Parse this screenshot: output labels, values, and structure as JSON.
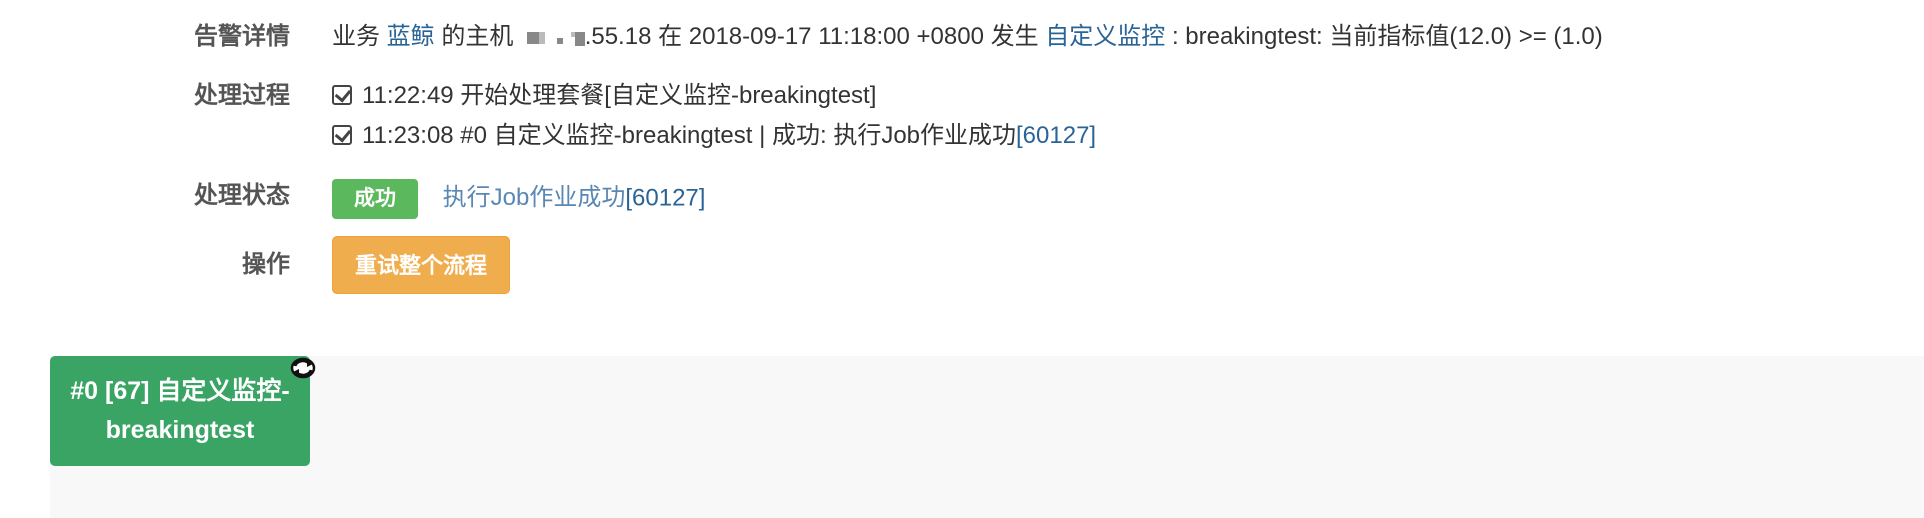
{
  "alert_details": {
    "label": "告警详情",
    "prefix": "业务",
    "business_name": "蓝鲸",
    "host_text": "的主机",
    "host_ip_suffix": ".55.18",
    "at_text": "在",
    "timestamp": "2018-09-17 11:18:00 +0800",
    "occur_text": "发生",
    "monitor_type": "自定义监控",
    "detail": ": breakingtest: 当前指标值(12.0) >= (1.0)"
  },
  "process": {
    "label": "处理过程",
    "steps": [
      {
        "text": "11:22:49 开始处理套餐[自定义监控-breakingtest]",
        "link": ""
      },
      {
        "text": "11:23:08 #0 自定义监控-breakingtest | 成功: 执行Job作业成功",
        "link": "[60127]"
      }
    ]
  },
  "status": {
    "label": "处理状态",
    "badge": "成功",
    "message": "执行Job作业成功",
    "message_link": "[60127]"
  },
  "actions": {
    "label": "操作",
    "retry_button": "重试整个流程"
  },
  "flow": {
    "node_title": "#0 [67] 自定义监控-breakingtest",
    "node_color": "#3aa465",
    "node_icon": "refresh-icon"
  }
}
